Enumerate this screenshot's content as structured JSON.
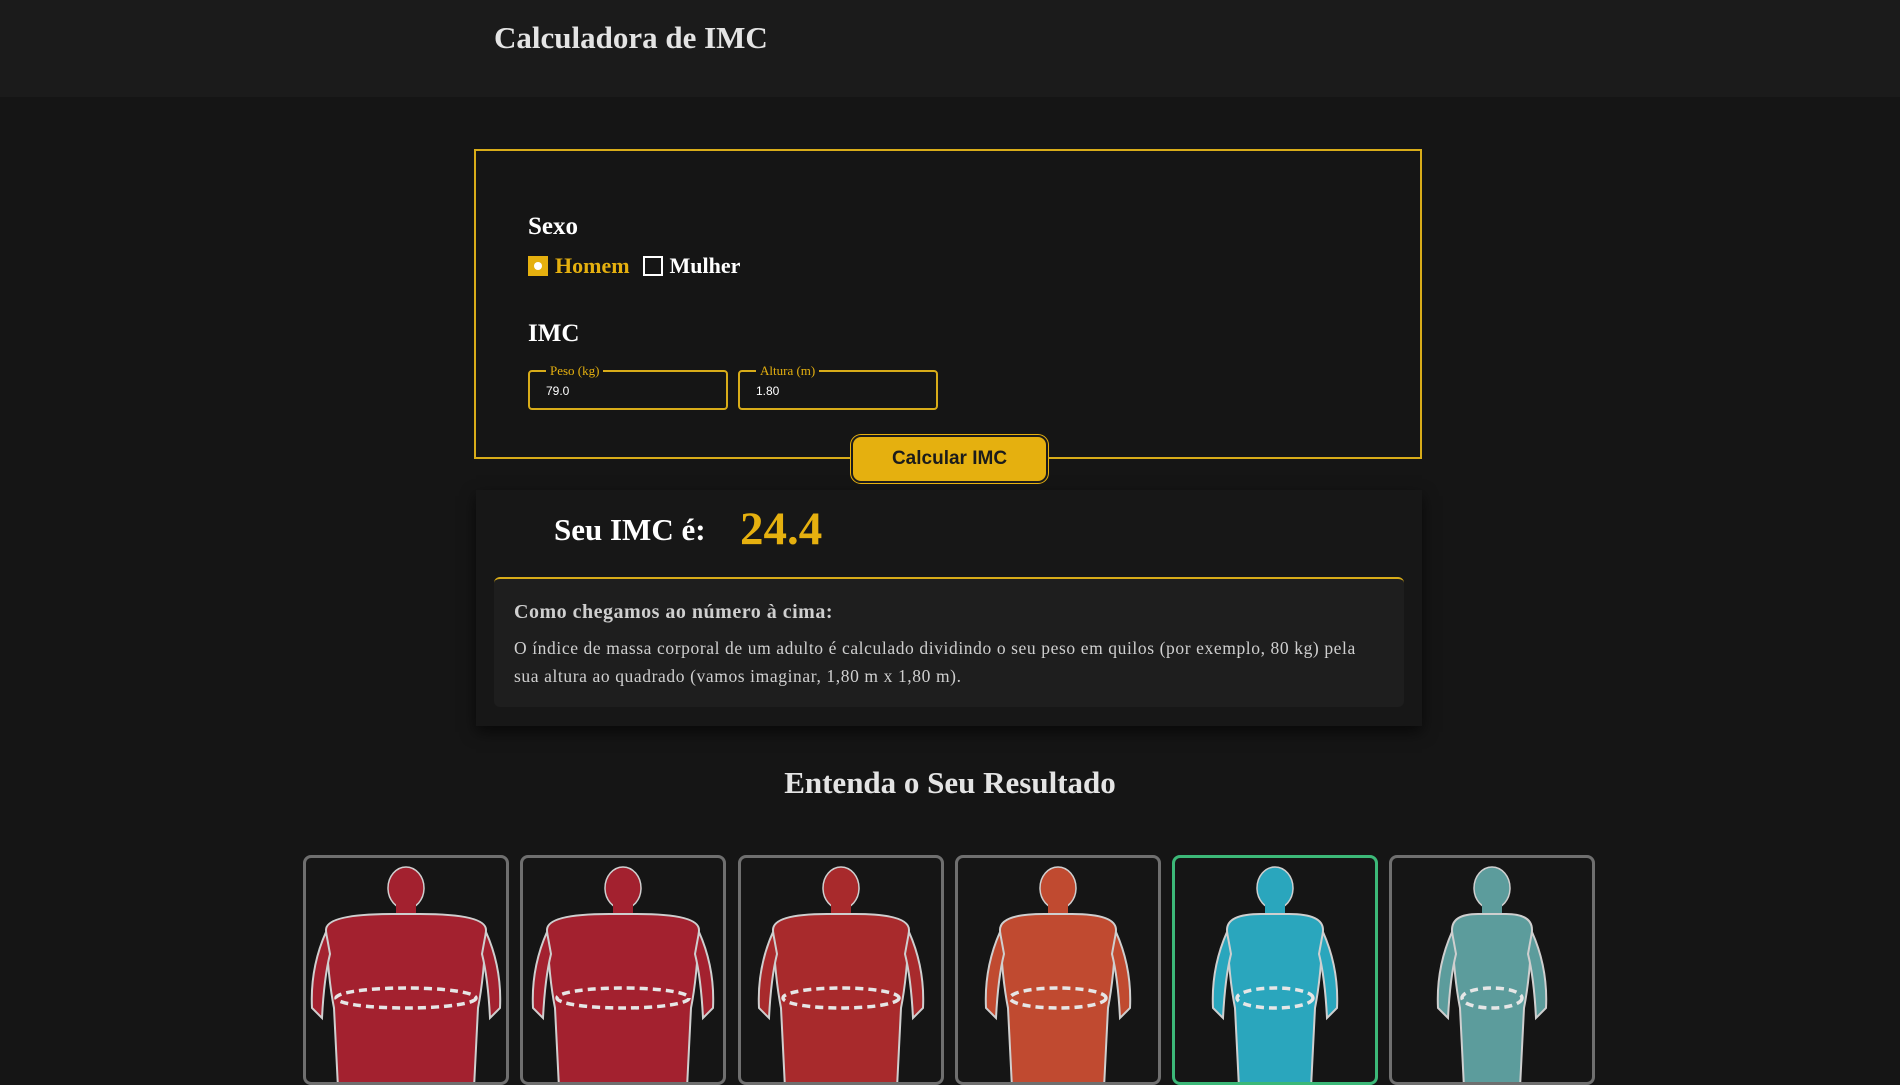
{
  "header": {
    "title": "Calculadora de IMC"
  },
  "form": {
    "sex_label": "Sexo",
    "sex_options": [
      {
        "label": "Homem",
        "selected": true
      },
      {
        "label": "Mulher",
        "selected": false
      }
    ],
    "imc_label": "IMC",
    "weight": {
      "label": "Peso (kg)",
      "value": "79.0"
    },
    "height": {
      "label": "Altura (m)",
      "value": "1.80"
    },
    "calculate_label": "Calcular IMC"
  },
  "result": {
    "label": "Seu IMC é:",
    "value": "24.4",
    "explain_title": "Como chegamos ao número à cima:",
    "explain_text": "O índice de massa corporal de um adulto é calculado dividindo o seu peso em quilos (por exemplo, 80 kg) pela sua altura ao quadrado (vamos imaginar, 1,80 m x 1,80 m)."
  },
  "categories": {
    "title": "Entenda o Seu Resultado",
    "cards": [
      {
        "icon": "obese-body-icon",
        "color": "#a3212f",
        "active": false
      },
      {
        "icon": "obese-body-icon",
        "color": "#a3212f",
        "active": false
      },
      {
        "icon": "obese-body-icon",
        "color": "#a82a2c",
        "active": false
      },
      {
        "icon": "overweight-body-icon",
        "color": "#c04a30",
        "active": false
      },
      {
        "icon": "normal-body-icon",
        "color": "#2aa6bd",
        "active": true
      },
      {
        "icon": "thin-body-icon",
        "color": "#5c9c9c",
        "active": false
      }
    ]
  },
  "colors": {
    "accent": "#e5b00f",
    "background": "#151515",
    "header_bg": "#1b1b1b",
    "active_border": "#3cb878"
  }
}
